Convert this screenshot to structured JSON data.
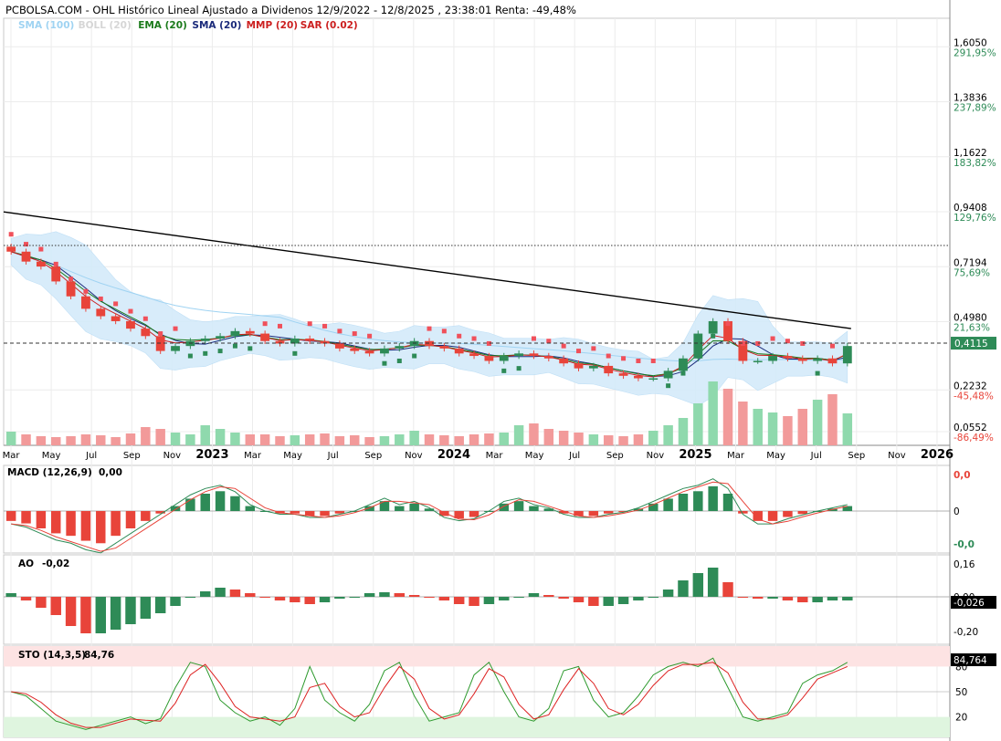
{
  "header": {
    "title": "PCBOLSA.COM - OHL Histórico Lineal Ajustado a Dividenos 12/9/2022 - 12/8/2025 , 23:38:01 Renta: -49,48%",
    "legend": [
      {
        "label": "SMA (100)",
        "color": "#9fd3f2"
      },
      {
        "label": "BOLL (20)",
        "color": "#d6d6d6"
      },
      {
        "label": "EMA (20)",
        "color": "#1a7a1a"
      },
      {
        "label": "SMA (20)",
        "color": "#1a2a7a"
      },
      {
        "label": "MMP (20)",
        "color": "#cc1f1f"
      },
      {
        "label": "SAR (0.02)",
        "color": "#cc1f1f"
      }
    ]
  },
  "colors": {
    "up": "#2e8b57",
    "down": "#e8443a",
    "vol_up": "#8fd9ad",
    "vol_down": "#f29a9a",
    "boll_fill": "#d4ebfa",
    "sar": "#f0505a",
    "sar_low": "#2e8b57",
    "sto_band_high": "#fde3e3",
    "sto_band_low": "#dff5df"
  },
  "price_axis": {
    "ticks": [
      {
        "price": "1,6050",
        "pct": "291,95%",
        "color": "#2e8b57"
      },
      {
        "price": "1,3836",
        "pct": "237,89%",
        "color": "#2e8b57"
      },
      {
        "price": "1,1622",
        "pct": "183,82%",
        "color": "#2e8b57"
      },
      {
        "price": "0,9408",
        "pct": "129,76%",
        "color": "#2e8b57"
      },
      {
        "price": "0,7194",
        "pct": "75,69%",
        "color": "#2e8b57"
      },
      {
        "price": "0,4980",
        "pct": "21,63%",
        "color": "#2e8b57"
      },
      {
        "price": "0,2232",
        "pct": "-45,48%",
        "color": "#e8443a"
      },
      {
        "price": "0,0552",
        "pct": "-86,49%",
        "color": "#e8443a"
      }
    ],
    "current_price": "0,4115"
  },
  "x_axis": {
    "labels": [
      {
        "text": "Mar",
        "bold": false
      },
      {
        "text": "May",
        "bold": false
      },
      {
        "text": "Jul",
        "bold": false
      },
      {
        "text": "Sep",
        "bold": false
      },
      {
        "text": "Nov",
        "bold": false
      },
      {
        "text": "2023",
        "bold": true
      },
      {
        "text": "Mar",
        "bold": false
      },
      {
        "text": "May",
        "bold": false
      },
      {
        "text": "Jul",
        "bold": false
      },
      {
        "text": "Sep",
        "bold": false
      },
      {
        "text": "Nov",
        "bold": false
      },
      {
        "text": "2024",
        "bold": true
      },
      {
        "text": "Mar",
        "bold": false
      },
      {
        "text": "May",
        "bold": false
      },
      {
        "text": "Jul",
        "bold": false
      },
      {
        "text": "Sep",
        "bold": false
      },
      {
        "text": "Nov",
        "bold": false
      },
      {
        "text": "2025",
        "bold": true
      },
      {
        "text": "Mar",
        "bold": false
      },
      {
        "text": "May",
        "bold": false
      },
      {
        "text": "Jul",
        "bold": false
      },
      {
        "text": "Sep",
        "bold": false
      },
      {
        "text": "Nov",
        "bold": false
      },
      {
        "text": "2026",
        "bold": true
      }
    ]
  },
  "panels": {
    "macd": {
      "label": "MACD (12,26,9)",
      "value": "0,00",
      "ticks": [
        {
          "text": "0,0",
          "color": "#e8443a"
        },
        {
          "text": "0",
          "color": "#000000"
        },
        {
          "text": "-0,0",
          "color": "#2e8b57"
        }
      ]
    },
    "ao": {
      "label": "AO",
      "value": "-0,02",
      "ticks": [
        "0,16",
        "0,00",
        "-0,20"
      ],
      "current": "-0,026"
    },
    "sto": {
      "label": "STO (14,3,5)",
      "value": "84,76",
      "ticks": [
        "80",
        "50",
        "20"
      ],
      "current": "84,764"
    }
  },
  "chart_data": {
    "type": "candlestick",
    "title": "PCBOLSA.COM - OHL Histórico Lineal Ajustado a Dividenos 12/9/2022 - 12/8/2025 , 23:38:01 Renta: -49,48%",
    "period": [
      "2022-09-12",
      "2025-08-12"
    ],
    "return_pct": -49.48,
    "ylim": [
      0.0,
      1.72
    ],
    "last_price": 0.4115,
    "trend_line": {
      "start": 0.94,
      "end": 0.47
    },
    "resistance_line": 0.805,
    "close": [
      0.78,
      0.74,
      0.72,
      0.66,
      0.6,
      0.55,
      0.52,
      0.5,
      0.47,
      0.44,
      0.38,
      0.4,
      0.42,
      0.43,
      0.44,
      0.46,
      0.45,
      0.42,
      0.41,
      0.43,
      0.42,
      0.41,
      0.39,
      0.38,
      0.37,
      0.39,
      0.4,
      0.42,
      0.4,
      0.39,
      0.37,
      0.36,
      0.34,
      0.36,
      0.37,
      0.36,
      0.35,
      0.33,
      0.31,
      0.32,
      0.29,
      0.28,
      0.27,
      0.27,
      0.3,
      0.35,
      0.45,
      0.5,
      0.42,
      0.34,
      0.34,
      0.36,
      0.35,
      0.34,
      0.35,
      0.33,
      0.4
    ],
    "volume": [
      15,
      12,
      10,
      9,
      10,
      12,
      11,
      9,
      13,
      20,
      18,
      14,
      12,
      22,
      18,
      14,
      12,
      12,
      10,
      11,
      12,
      13,
      10,
      11,
      9,
      10,
      12,
      16,
      12,
      11,
      10,
      12,
      13,
      14,
      22,
      24,
      18,
      16,
      14,
      12,
      11,
      10,
      12,
      16,
      22,
      30,
      46,
      70,
      62,
      48,
      40,
      36,
      32,
      40,
      50,
      56,
      35
    ],
    "macd_hist": [
      -0.02,
      -0.025,
      -0.035,
      -0.045,
      -0.05,
      -0.06,
      -0.065,
      -0.05,
      -0.035,
      -0.02,
      -0.005,
      0.01,
      0.025,
      0.035,
      0.04,
      0.03,
      0.01,
      0.0,
      -0.005,
      -0.005,
      -0.01,
      -0.01,
      -0.005,
      0.0,
      0.01,
      0.02,
      0.01,
      0.015,
      0.005,
      -0.01,
      -0.015,
      -0.012,
      0.0,
      0.015,
      0.02,
      0.01,
      0.005,
      -0.005,
      -0.01,
      -0.01,
      -0.005,
      -0.002,
      0.005,
      0.015,
      0.025,
      0.035,
      0.04,
      0.05,
      0.035,
      -0.005,
      -0.02,
      -0.02,
      -0.012,
      -0.006,
      0.0,
      0.005,
      0.01
    ],
    "ao": [
      0.02,
      -0.02,
      -0.06,
      -0.1,
      -0.16,
      -0.2,
      -0.2,
      -0.18,
      -0.15,
      -0.12,
      -0.09,
      -0.05,
      0.0,
      0.03,
      0.05,
      0.04,
      0.02,
      0.0,
      -0.02,
      -0.03,
      -0.04,
      -0.03,
      -0.01,
      0.0,
      0.02,
      0.025,
      0.02,
      0.01,
      0.0,
      -0.02,
      -0.04,
      -0.05,
      -0.04,
      -0.02,
      0.0,
      0.02,
      0.01,
      -0.01,
      -0.03,
      -0.05,
      -0.05,
      -0.04,
      -0.02,
      0.0,
      0.04,
      0.09,
      0.13,
      0.16,
      0.08,
      0.0,
      -0.01,
      -0.01,
      -0.02,
      -0.03,
      -0.03,
      -0.02,
      -0.02
    ],
    "stochastic_k": [
      50,
      45,
      30,
      15,
      10,
      5,
      10,
      15,
      20,
      12,
      18,
      55,
      85,
      80,
      40,
      25,
      15,
      20,
      10,
      30,
      80,
      40,
      25,
      15,
      35,
      75,
      85,
      45,
      15,
      20,
      25,
      70,
      85,
      50,
      20,
      15,
      30,
      75,
      80,
      40,
      20,
      25,
      45,
      70,
      80,
      85,
      80,
      90,
      55,
      20,
      15,
      20,
      25,
      60,
      70,
      75,
      85
    ]
  }
}
